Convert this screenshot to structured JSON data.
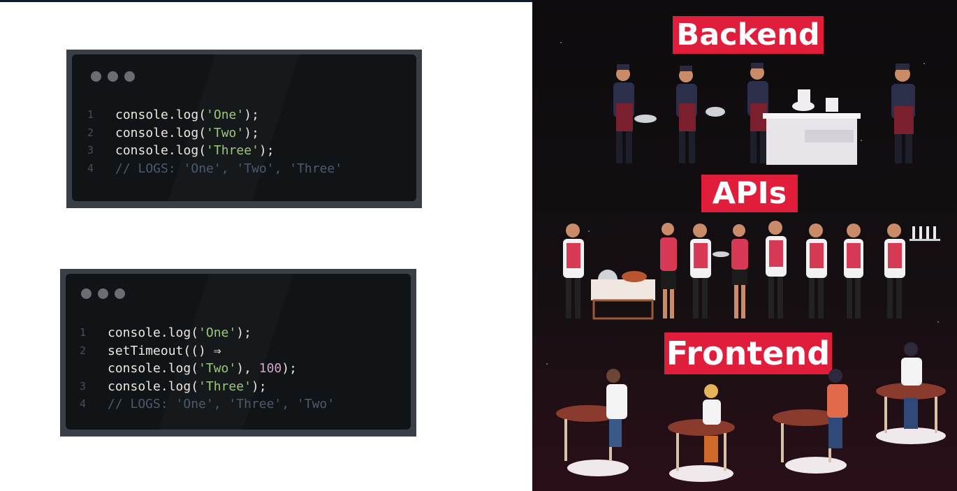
{
  "snippet1": {
    "lines": [
      {
        "num": "1",
        "pre": "console.log(",
        "str": "'One'",
        "post": ");"
      },
      {
        "num": "2",
        "pre": "console.log(",
        "str": "'Two'",
        "post": ");"
      },
      {
        "num": "3",
        "pre": "console.log(",
        "str": "'Three'",
        "post": ");"
      },
      {
        "num": "4",
        "comment": "// LOGS: 'One', 'Two', 'Three'"
      }
    ]
  },
  "snippet2": {
    "line1": {
      "num": "1",
      "pre": "console.log(",
      "str": "'One'",
      "post": ");"
    },
    "line2a": {
      "num": "2",
      "text": "setTimeout(() ⇒"
    },
    "line2b": {
      "pre": "console.log(",
      "str": "'Two'",
      "mid": "), ",
      "num_value": "100",
      "post": ");"
    },
    "line3": {
      "num": "3",
      "pre": "console.log(",
      "str": "'Three'",
      "post": ");"
    },
    "line4": {
      "num": "4",
      "comment": "// LOGS: 'One', 'Three', 'Two'"
    }
  },
  "illustration": {
    "backend_label": "Backend",
    "apis_label": "APIs",
    "frontend_label": "Frontend"
  },
  "colors": {
    "label_red": "#e01e3b",
    "string_green": "#9dc77a",
    "number_pink": "#d2a6c9",
    "comment_gray": "#4c5a6b"
  }
}
